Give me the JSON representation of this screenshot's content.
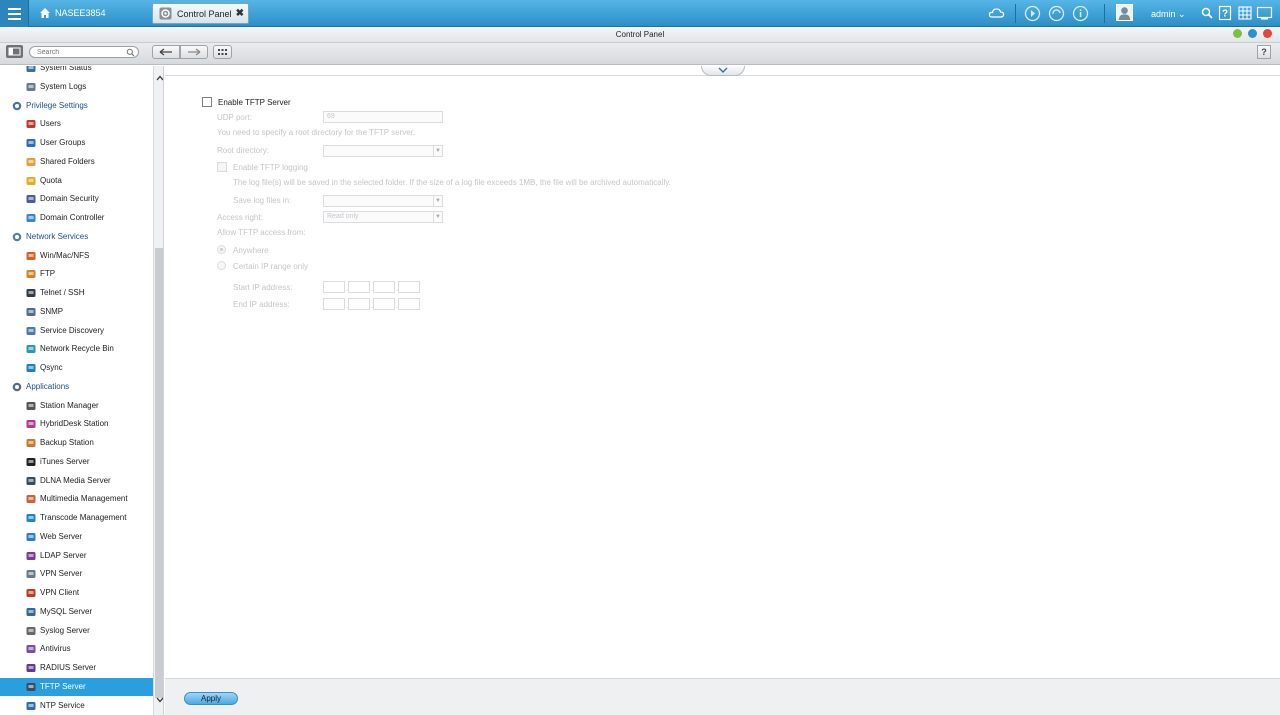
{
  "topbar": {
    "home_label": "NASEE3854",
    "active_tab": "Control Panel",
    "tab_close": "✖",
    "user": "admin"
  },
  "window": {
    "title": "Control Panel"
  },
  "toolbar": {
    "search_placeholder": "Search",
    "help": "?"
  },
  "sidebar": {
    "rows": [
      {
        "type": "item",
        "label": "System Status",
        "icon": "monitor-icon"
      },
      {
        "type": "item",
        "label": "System Logs",
        "icon": "log-icon"
      },
      {
        "type": "section",
        "label": "Privilege Settings",
        "icon": "person-icon"
      },
      {
        "type": "item",
        "label": "Users",
        "icon": "user-icon"
      },
      {
        "type": "item",
        "label": "User Groups",
        "icon": "user-group-icon"
      },
      {
        "type": "item",
        "label": "Shared Folders",
        "icon": "folder-icon"
      },
      {
        "type": "item",
        "label": "Quota",
        "icon": "quota-icon"
      },
      {
        "type": "item",
        "label": "Domain Security",
        "icon": "domain-security-icon"
      },
      {
        "type": "item",
        "label": "Domain Controller",
        "icon": "domain-controller-icon"
      },
      {
        "type": "section",
        "label": "Network Services",
        "icon": "globe-icon"
      },
      {
        "type": "item",
        "label": "Win/Mac/NFS",
        "icon": "network-share-icon"
      },
      {
        "type": "item",
        "label": "FTP",
        "icon": "ftp-icon"
      },
      {
        "type": "item",
        "label": "Telnet / SSH",
        "icon": "terminal-icon"
      },
      {
        "type": "item",
        "label": "SNMP",
        "icon": "snmp-icon"
      },
      {
        "type": "item",
        "label": "Service Discovery",
        "icon": "discovery-icon"
      },
      {
        "type": "item",
        "label": "Network Recycle Bin",
        "icon": "recycle-bin-icon"
      },
      {
        "type": "item",
        "label": "Qsync",
        "icon": "sync-icon"
      },
      {
        "type": "section",
        "label": "Applications",
        "icon": "applications-icon"
      },
      {
        "type": "item",
        "label": "Station Manager",
        "icon": "station-icon"
      },
      {
        "type": "item",
        "label": "HybridDesk Station",
        "icon": "hd-icon"
      },
      {
        "type": "item",
        "label": "Backup Station",
        "icon": "backup-icon"
      },
      {
        "type": "item",
        "label": "iTunes Server",
        "icon": "music-icon"
      },
      {
        "type": "item",
        "label": "DLNA Media Server",
        "icon": "media-server-icon"
      },
      {
        "type": "item",
        "label": "Multimedia Management",
        "icon": "multimedia-icon"
      },
      {
        "type": "item",
        "label": "Transcode Management",
        "icon": "transcode-icon"
      },
      {
        "type": "item",
        "label": "Web Server",
        "icon": "web-icon"
      },
      {
        "type": "item",
        "label": "LDAP Server",
        "icon": "ldap-icon"
      },
      {
        "type": "item",
        "label": "VPN Server",
        "icon": "vpn-server-icon"
      },
      {
        "type": "item",
        "label": "VPN Client",
        "icon": "vpn-client-icon"
      },
      {
        "type": "item",
        "label": "MySQL Server",
        "icon": "database-icon"
      },
      {
        "type": "item",
        "label": "Syslog Server",
        "icon": "syslog-icon"
      },
      {
        "type": "item",
        "label": "Antivirus",
        "icon": "antivirus-icon"
      },
      {
        "type": "item",
        "label": "RADIUS Server",
        "icon": "radius-icon"
      },
      {
        "type": "item",
        "label": "TFTP Server",
        "icon": "tftp-icon",
        "selected": true
      },
      {
        "type": "item",
        "label": "NTP Service",
        "icon": "ntp-icon"
      }
    ]
  },
  "form": {
    "enable_tftp": "Enable TFTP Server",
    "udp_port_label": "UDP port:",
    "udp_port_value": "69",
    "root_hint": "You need to specify a root directory for the TFTP server.",
    "root_dir_label": "Root directory:",
    "enable_logging": "Enable TFTP logging",
    "log_hint": "The log file(s) will be saved in the selected folder. If the size of a log file exceeds 1MB, the file will be archived automatically.",
    "save_log_label": "Save log files in:",
    "access_right_label": "Access right:",
    "access_right_value": "Read only",
    "allow_access_label": "Allow TFTP access from:",
    "anywhere": "Anywhere",
    "ip_range_only": "Certain IP range only",
    "start_ip_label": "Start IP address:",
    "end_ip_label": "End IP address:"
  },
  "footer": {
    "apply": "Apply"
  }
}
